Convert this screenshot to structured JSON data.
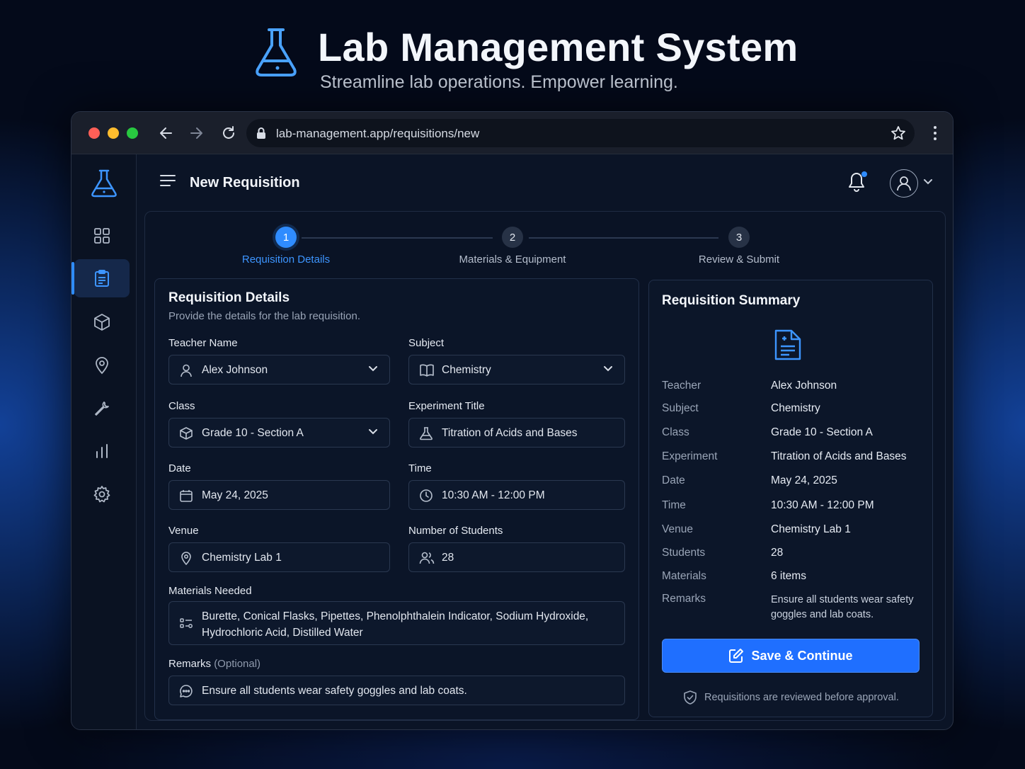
{
  "hero": {
    "title": "Lab Management System",
    "subtitle": "Streamline lab operations. Empower learning.",
    "icon": "flask-icon"
  },
  "browser": {
    "url": "lab-management.app/requisitions/new"
  },
  "sidebar": {
    "items": [
      {
        "icon": "dashboard-grid-icon",
        "active": false
      },
      {
        "icon": "clipboard-icon",
        "active": true
      },
      {
        "icon": "cube-icon",
        "active": false
      },
      {
        "icon": "map-pin-icon",
        "active": false
      },
      {
        "icon": "wrench-icon",
        "active": false
      },
      {
        "icon": "bar-chart-icon",
        "active": false
      },
      {
        "icon": "gear-icon",
        "active": false
      }
    ]
  },
  "topbar": {
    "title": "New Requisition"
  },
  "steps": [
    {
      "number": "1",
      "label": "Requisition Details",
      "active": true
    },
    {
      "number": "2",
      "label": "Materials & Equipment",
      "active": false
    },
    {
      "number": "3",
      "label": "Review & Submit",
      "active": false
    }
  ],
  "form": {
    "title": "Requisition Details",
    "description": "Provide the details for the lab requisition.",
    "teacher": {
      "label": "Teacher Name",
      "value": "Alex Johnson"
    },
    "subject": {
      "label": "Subject",
      "value": "Chemistry"
    },
    "class": {
      "label": "Class",
      "value": "Grade 10 - Section A"
    },
    "experiment": {
      "label": "Experiment Title",
      "value": "Titration of Acids and Bases"
    },
    "date": {
      "label": "Date",
      "value": "May 24, 2025"
    },
    "time": {
      "label": "Time",
      "value": "10:30 AM - 12:00 PM"
    },
    "venue": {
      "label": "Venue",
      "value": "Chemistry Lab 1"
    },
    "students": {
      "label": "Number of Students",
      "value": "28"
    },
    "materials": {
      "label": "Materials Needed",
      "value": "Burette, Conical Flasks, Pipettes, Phenolphthalein Indicator, Sodium Hydroxide, Hydrochloric Acid, Distilled Water"
    },
    "remarks": {
      "label": "Remarks",
      "optional": "(Optional)",
      "value": "Ensure all students wear safety goggles and lab coats."
    }
  },
  "summary": {
    "title": "Requisition Summary",
    "rows": [
      {
        "key": "Teacher",
        "value": "Alex Johnson"
      },
      {
        "key": "Subject",
        "value": "Chemistry"
      },
      {
        "key": "Class",
        "value": "Grade 10 - Section A"
      },
      {
        "key": "Experiment",
        "value": "Titration of Acids and Bases"
      },
      {
        "key": "Date",
        "value": "May 24, 2025"
      },
      {
        "key": "Time",
        "value": "10:30 AM - 12:00 PM"
      },
      {
        "key": "Venue",
        "value": "Chemistry Lab 1"
      },
      {
        "key": "Students",
        "value": "28"
      },
      {
        "key": "Materials",
        "value": "6 items"
      },
      {
        "key": "Remarks",
        "value": "Ensure all students wear safety goggles and lab coats."
      }
    ],
    "button": "Save & Continue",
    "note": "Requisitions are reviewed before approval."
  },
  "colors": {
    "accent": "#2f8cff",
    "button": "#1f6fff",
    "background": "#040a1a"
  }
}
